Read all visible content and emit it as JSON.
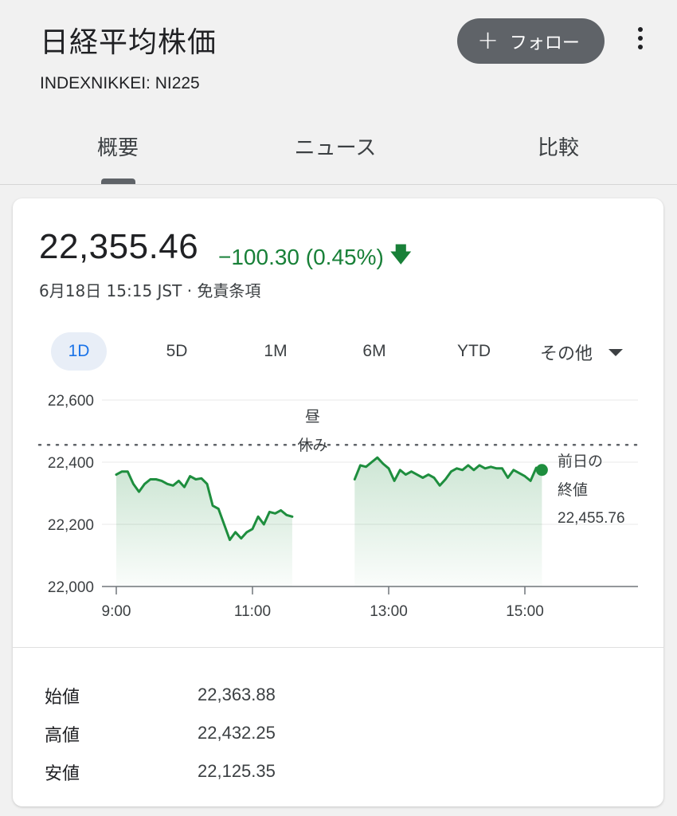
{
  "header": {
    "title": "日経平均株価",
    "ticker": "INDEXNIKKEI: NI225",
    "follow_label": "フォロー",
    "tabs": [
      "概要",
      "ニュース",
      "比較"
    ],
    "active_tab": 0
  },
  "quote": {
    "price": "22,355.46",
    "change": "−100.30 (0.45%)",
    "timestamp": "6月18日 15:15 JST · 免責条項",
    "change_color": "#188038"
  },
  "ranges": {
    "items": [
      "1D",
      "5D",
      "1M",
      "6M",
      "YTD"
    ],
    "active": "1D",
    "more_label": "その他"
  },
  "chart_data": {
    "type": "line",
    "y_ticks": [
      "22,600",
      "22,400",
      "22,200",
      "22,000"
    ],
    "x_ticks": [
      "9:00",
      "11:00",
      "13:00",
      "15:00"
    ],
    "ylim": [
      22000,
      22600
    ],
    "grid": true,
    "break_label_top": "昼",
    "break_label_bottom": "休み",
    "prev_close_label_1": "前日の",
    "prev_close_label_2": "終値",
    "prev_close_value": "22,455.76",
    "prev_close": 22455.76,
    "line_color": "#1e8e3e",
    "series": [
      {
        "segment": "morning",
        "points": [
          [
            "9:00",
            22360
          ],
          [
            "9:05",
            22370
          ],
          [
            "9:10",
            22370
          ],
          [
            "9:15",
            22330
          ],
          [
            "9:20",
            22305
          ],
          [
            "9:25",
            22330
          ],
          [
            "9:30",
            22345
          ],
          [
            "9:35",
            22345
          ],
          [
            "9:40",
            22340
          ],
          [
            "9:45",
            22330
          ],
          [
            "9:50",
            22325
          ],
          [
            "9:55",
            22340
          ],
          [
            "10:00",
            22320
          ],
          [
            "10:05",
            22355
          ],
          [
            "10:10",
            22345
          ],
          [
            "10:15",
            22348
          ],
          [
            "10:20",
            22330
          ],
          [
            "10:25",
            22260
          ],
          [
            "10:30",
            22250
          ],
          [
            "10:35",
            22200
          ],
          [
            "10:40",
            22150
          ],
          [
            "10:45",
            22175
          ],
          [
            "10:50",
            22155
          ],
          [
            "10:55",
            22175
          ],
          [
            "11:00",
            22185
          ],
          [
            "11:05",
            22225
          ],
          [
            "11:10",
            22200
          ],
          [
            "11:15",
            22240
          ],
          [
            "11:20",
            22235
          ],
          [
            "11:25",
            22245
          ],
          [
            "11:30",
            22230
          ],
          [
            "11:35",
            22225
          ]
        ]
      },
      {
        "segment": "afternoon",
        "points": [
          [
            "12:30",
            22345
          ],
          [
            "12:35",
            22390
          ],
          [
            "12:40",
            22385
          ],
          [
            "12:45",
            22400
          ],
          [
            "12:50",
            22415
          ],
          [
            "12:55",
            22395
          ],
          [
            "13:00",
            22380
          ],
          [
            "13:05",
            22340
          ],
          [
            "13:10",
            22375
          ],
          [
            "13:15",
            22360
          ],
          [
            "13:20",
            22370
          ],
          [
            "13:25",
            22360
          ],
          [
            "13:30",
            22350
          ],
          [
            "13:35",
            22360
          ],
          [
            "13:40",
            22350
          ],
          [
            "13:45",
            22325
          ],
          [
            "13:50",
            22345
          ],
          [
            "13:55",
            22370
          ],
          [
            "14:00",
            22380
          ],
          [
            "14:05",
            22375
          ],
          [
            "14:10",
            22390
          ],
          [
            "14:15",
            22375
          ],
          [
            "14:20",
            22390
          ],
          [
            "14:25",
            22380
          ],
          [
            "14:30",
            22385
          ],
          [
            "14:35",
            22380
          ],
          [
            "14:40",
            22380
          ],
          [
            "14:45",
            22350
          ],
          [
            "14:50",
            22375
          ],
          [
            "14:55",
            22365
          ],
          [
            "15:00",
            22355
          ],
          [
            "15:05",
            22340
          ],
          [
            "15:10",
            22382
          ],
          [
            "15:15",
            22375
          ]
        ]
      }
    ]
  },
  "stats": [
    {
      "label": "始値",
      "value": "22,363.88"
    },
    {
      "label": "高値",
      "value": "22,432.25"
    },
    {
      "label": "安値",
      "value": "22,125.35"
    }
  ]
}
